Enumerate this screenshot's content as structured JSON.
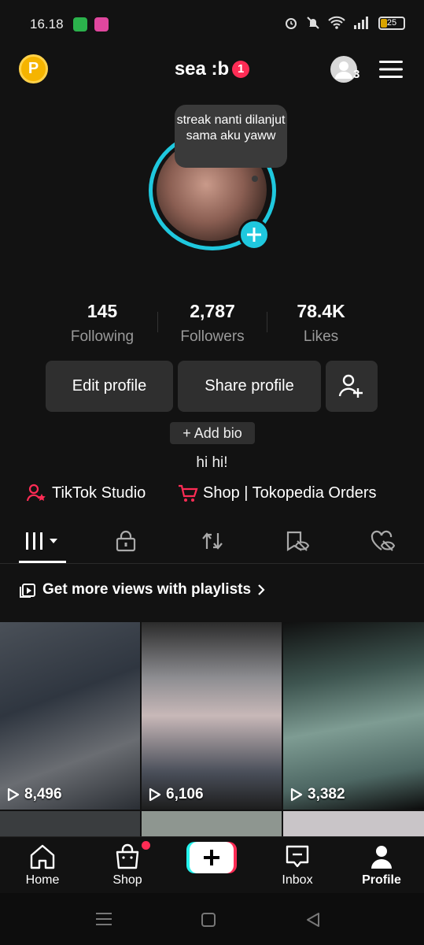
{
  "status_bar": {
    "time": "16.18",
    "battery": "25"
  },
  "header": {
    "coin_label": "P",
    "username": "sea :b",
    "notification_count": "1",
    "friends_count": "3"
  },
  "avatar": {
    "note_text": "streak nanti dilanjut sama aku yaww"
  },
  "stats": [
    {
      "value": "145",
      "label": "Following"
    },
    {
      "value": "2,787",
      "label": "Followers"
    },
    {
      "value": "78.4K",
      "label": "Likes"
    }
  ],
  "actions": {
    "edit_profile": "Edit profile",
    "share_profile": "Share profile",
    "add_bio": "+ Add bio"
  },
  "bio": "hi hi!",
  "links": {
    "studio": "TikTok Studio",
    "shop": "Shop | Tokopedia Orders"
  },
  "tabs": [
    "videos-grid-icon",
    "lock-icon",
    "repost-icon",
    "favorites-icon",
    "liked-icon"
  ],
  "playlist_prompt": "Get more views with playlists",
  "videos": [
    {
      "views": "8,496"
    },
    {
      "views": "6,106"
    },
    {
      "views": "3,382"
    }
  ],
  "bottom_nav": {
    "home": "Home",
    "shop": "Shop",
    "inbox": "Inbox",
    "profile": "Profile"
  },
  "colors": {
    "background": "#121212",
    "accent_cyan": "#1fc8de",
    "accent_red": "#fe2c55",
    "button_bg": "#2f2f2f",
    "coin": "#f5b400"
  }
}
